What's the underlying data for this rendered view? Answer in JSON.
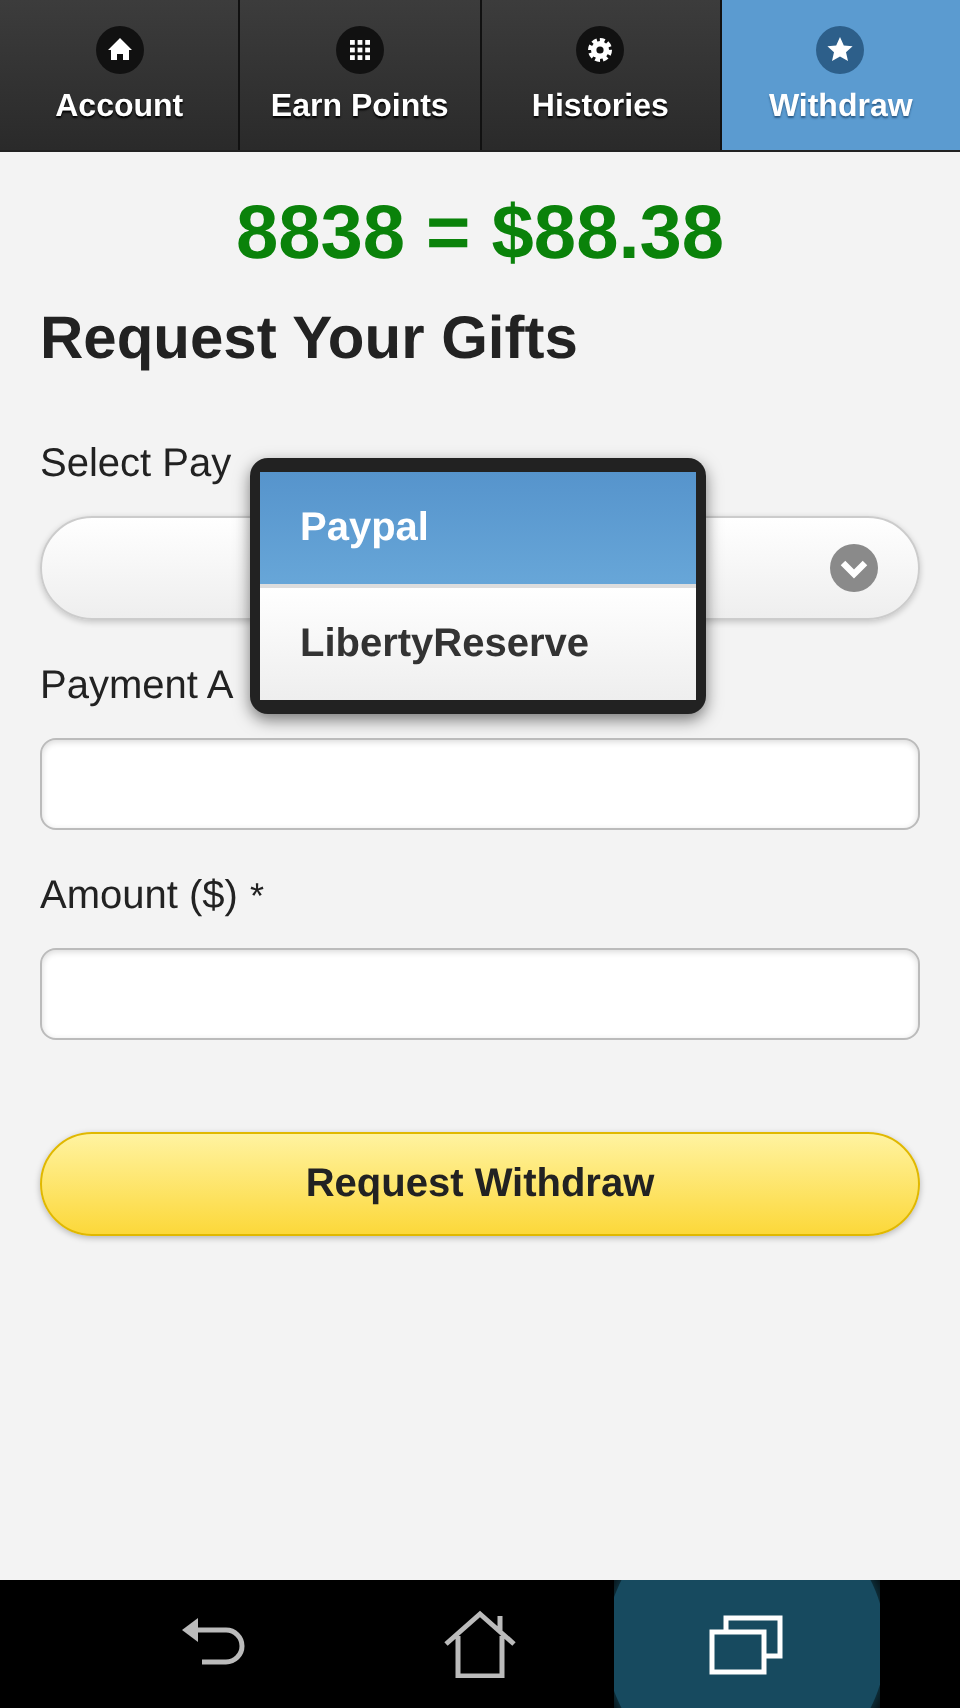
{
  "tabs": [
    {
      "label": "Account",
      "selected": false
    },
    {
      "label": "Earn Points",
      "selected": false
    },
    {
      "label": "Histories",
      "selected": false
    },
    {
      "label": "Withdraw",
      "selected": true
    }
  ],
  "balance": "8838 = $88.38",
  "heading": "Request Your Gifts",
  "form": {
    "method_label": "Select Pay",
    "account_label": "Payment A",
    "amount_label": "Amount ($)",
    "required_mark": "*",
    "submit": "Request Withdraw"
  },
  "dropdown_options": [
    {
      "label": "Paypal",
      "selected": true
    },
    {
      "label": "LibertyReserve",
      "selected": false
    }
  ],
  "nav_buttons": [
    {
      "selected": false
    },
    {
      "selected": false
    },
    {
      "selected": true
    }
  ]
}
